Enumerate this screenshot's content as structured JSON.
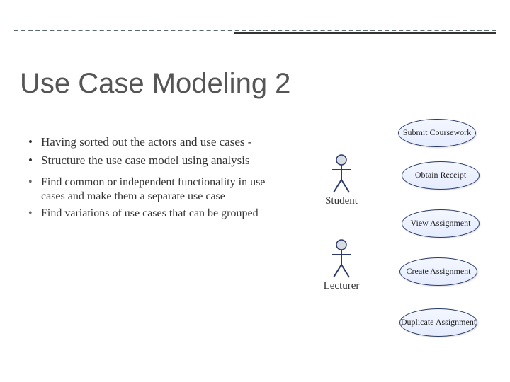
{
  "title": "Use Case Modeling 2",
  "bullets": {
    "b1": "Having sorted out the actors and use cases -",
    "b2": "Structure the use case model using analysis",
    "sub1": "Find common or independent functionality in use cases and make them a separate use case",
    "sub2": "Find variations of use cases that can be grouped"
  },
  "actors": {
    "student": "Student",
    "lecturer": "Lecturer"
  },
  "usecases": {
    "submit": "Submit Coursework",
    "obtain": "Obtain Receipt",
    "view": "View Assignment",
    "create": "Create Assignment",
    "duplicate": "Duplicate Assignment"
  }
}
